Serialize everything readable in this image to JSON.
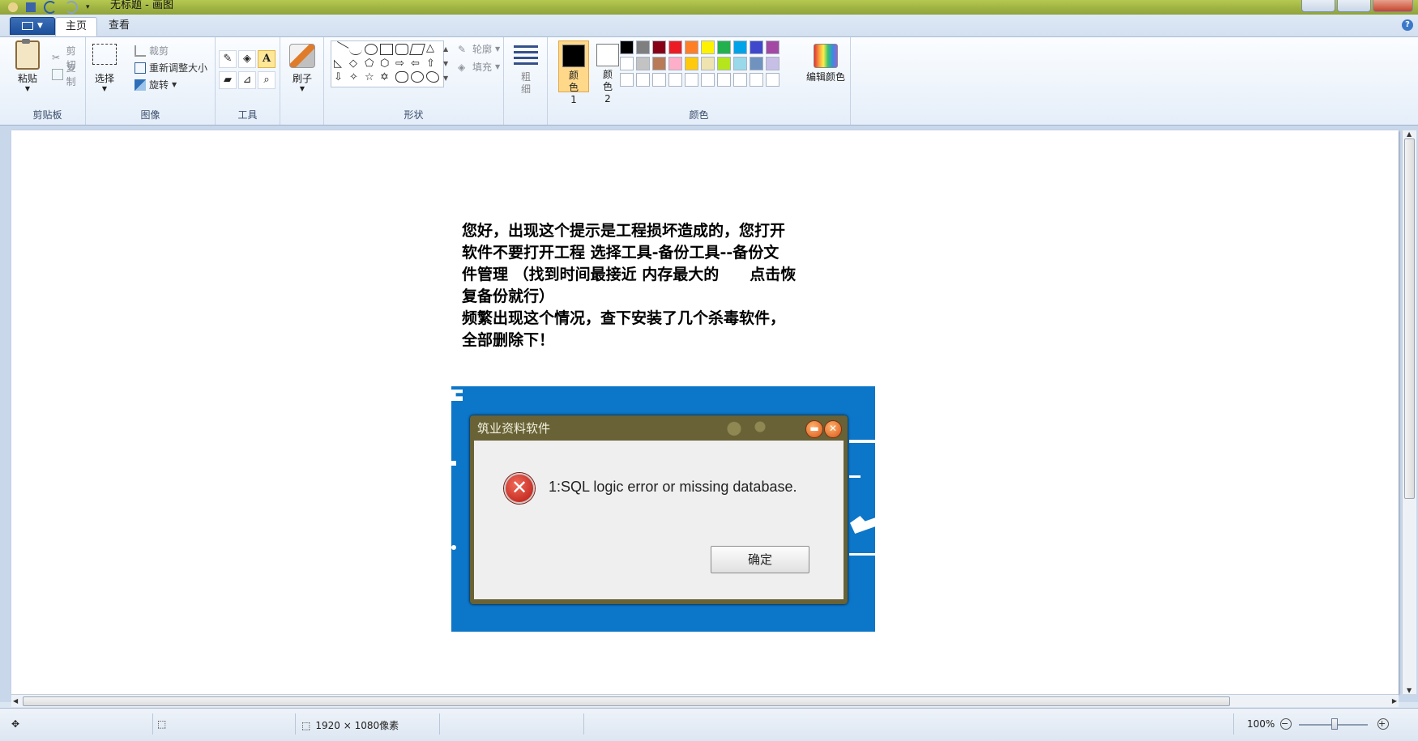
{
  "window": {
    "title": "无标题 - 画图"
  },
  "tabs": [
    {
      "label": "主页"
    },
    {
      "label": "查看"
    }
  ],
  "ribbon": {
    "clipboard": {
      "label": "剪贴板",
      "paste": "粘贴",
      "cut": "剪切",
      "copy": "复制"
    },
    "image": {
      "label": "图像",
      "select": "选择",
      "crop": "裁剪",
      "resize": "重新调整大小",
      "rotate": "旋转"
    },
    "tools": {
      "label": "工具"
    },
    "brushes": {
      "label": "刷子"
    },
    "shapes": {
      "label": "形状",
      "outline": "轮廓",
      "fill": "填充"
    },
    "size": {
      "label": "粗细"
    },
    "colors": {
      "label": "颜色",
      "color1": "颜色 1",
      "color2": "颜色 2",
      "edit": "编辑颜色",
      "color1_value": "#000000",
      "color2_value": "#ffffff",
      "palette_row1": [
        "#000000",
        "#7f7f7f",
        "#880015",
        "#ed1c24",
        "#ff7f27",
        "#fff200",
        "#22b14c",
        "#00a2e8",
        "#3f48cc",
        "#a349a4"
      ],
      "palette_row2": [
        "#ffffff",
        "#c3c3c3",
        "#b97a57",
        "#ffaec9",
        "#ffc90e",
        "#efe4b0",
        "#b5e61d",
        "#99d9ea",
        "#7092be",
        "#c8bfe7"
      ]
    }
  },
  "canvas": {
    "message": "您好，出现这个提示是工程损坏造成的，您打开\n软件不要打开工程 选择工具-备份工具--备份文\n件管理 （找到时间最接近 内存最大的　　点击恢\n复备份就行）\n频繁出现这个情况，查下安装了几个杀毒软件，\n全部删除下！",
    "dialog": {
      "title": "筑业资料软件",
      "error": "1:SQL logic error or missing database.",
      "ok": "确定"
    }
  },
  "status": {
    "dimensions": "1920 × 1080像素",
    "zoom": "100%"
  }
}
